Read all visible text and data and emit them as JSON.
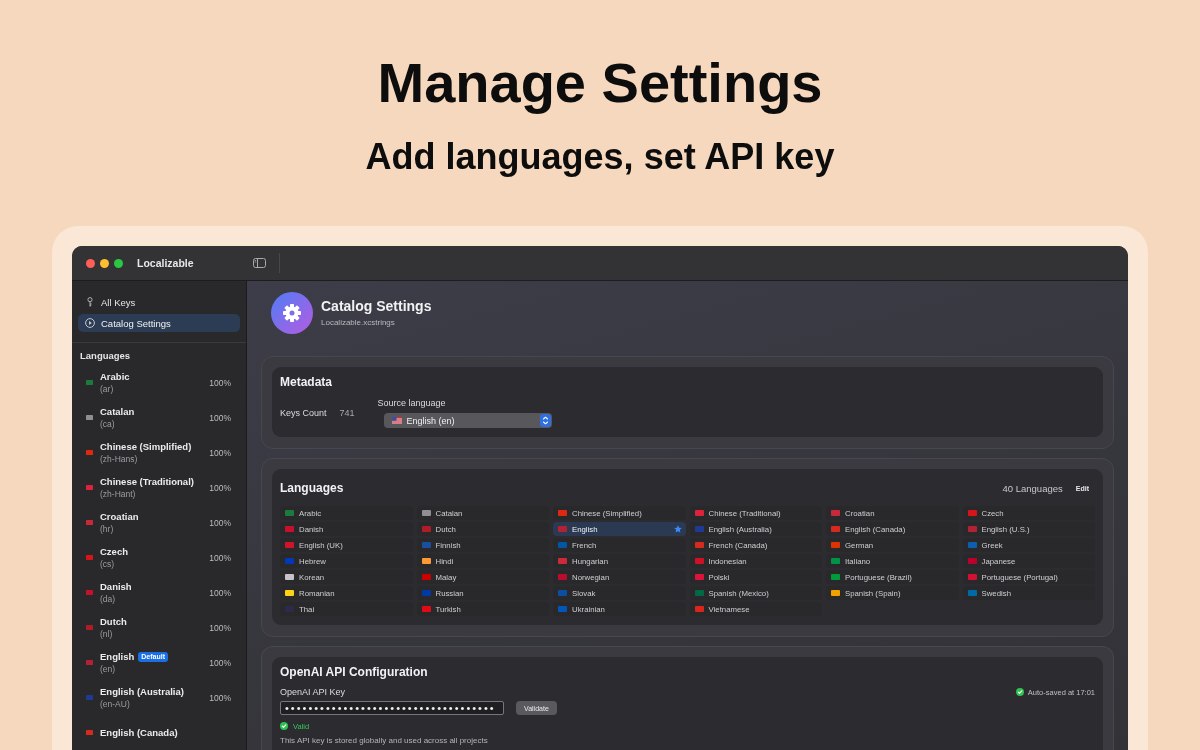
{
  "hero": {
    "title": "Manage Settings",
    "subtitle": "Add languages, set API key"
  },
  "window": {
    "title": "Localizable"
  },
  "sidebar": {
    "nav": [
      {
        "kind": "keys",
        "label": "All Keys",
        "selected": false
      },
      {
        "kind": "settings",
        "label": "Catalog Settings",
        "selected": true
      }
    ],
    "section_title": "Languages",
    "languages": [
      {
        "name": "Arabic",
        "code": "(ar)",
        "percent": "100%",
        "color": "#1d7a3d"
      },
      {
        "name": "Catalan",
        "code": "(ca)",
        "percent": "100%",
        "color": "#8e8e93"
      },
      {
        "name": "Chinese (Simplified)",
        "code": "(zh-Hans)",
        "percent": "100%",
        "color": "#de2910"
      },
      {
        "name": "Chinese (Traditional)",
        "code": "(zh-Hant)",
        "percent": "100%",
        "color": "#d9243c"
      },
      {
        "name": "Croatian",
        "code": "(hr)",
        "percent": "100%",
        "color": "#c8283b"
      },
      {
        "name": "Czech",
        "code": "(cs)",
        "percent": "100%",
        "color": "#d7141a"
      },
      {
        "name": "Danish",
        "code": "(da)",
        "percent": "100%",
        "color": "#c8102e"
      },
      {
        "name": "Dutch",
        "code": "(nl)",
        "percent": "100%",
        "color": "#ae1c28"
      },
      {
        "name": "English",
        "badge": "Default",
        "code": "(en)",
        "percent": "100%",
        "color": "#b22234"
      },
      {
        "name": "English (Australia)",
        "code": "(en-AU)",
        "percent": "100%",
        "color": "#1f3a93"
      },
      {
        "name": "English (Canada)",
        "color": "#d52b1e"
      }
    ]
  },
  "header": {
    "title": "Catalog Settings",
    "subtitle": "Localizable.xcstrings"
  },
  "metadata": {
    "title": "Metadata",
    "keys_count_label": "Keys Count",
    "keys_count": "741",
    "source_label": "Source language",
    "source_value": "English (en)"
  },
  "languages": {
    "title": "Languages",
    "count": "40 Languages",
    "edit": "Edit",
    "items": [
      {
        "name": "Arabic",
        "color": "#1d7a3d",
        "selected": false,
        "starred": false
      },
      {
        "name": "Catalan",
        "color": "#8e8e93",
        "selected": false,
        "starred": false
      },
      {
        "name": "Chinese (Simplified)",
        "color": "#de2910",
        "selected": false,
        "starred": false
      },
      {
        "name": "Chinese (Traditional)",
        "color": "#d9243c",
        "selected": false,
        "starred": false
      },
      {
        "name": "Croatian",
        "color": "#c8283b",
        "selected": false,
        "starred": false
      },
      {
        "name": "Czech",
        "color": "#d7141a",
        "selected": false,
        "starred": false
      },
      {
        "name": "Danish",
        "color": "#c8102e",
        "selected": false,
        "starred": false
      },
      {
        "name": "Dutch",
        "color": "#ae1c28",
        "selected": false,
        "starred": false
      },
      {
        "name": "English",
        "color": "#b22234",
        "selected": true,
        "starred": true
      },
      {
        "name": "English (Australia)",
        "color": "#1f3a93",
        "selected": false,
        "starred": false
      },
      {
        "name": "English (Canada)",
        "color": "#d52b1e",
        "selected": false,
        "starred": false
      },
      {
        "name": "English (U.S.)",
        "color": "#b22234",
        "selected": false,
        "starred": false
      },
      {
        "name": "English (UK)",
        "color": "#cf142b",
        "selected": false,
        "starred": false
      },
      {
        "name": "Finnish",
        "color": "#1a4fa0",
        "selected": false,
        "starred": false
      },
      {
        "name": "French",
        "color": "#0055a4",
        "selected": false,
        "starred": false
      },
      {
        "name": "French (Canada)",
        "color": "#d52b1e",
        "selected": false,
        "starred": false
      },
      {
        "name": "German",
        "color": "#dd3300",
        "selected": false,
        "starred": false
      },
      {
        "name": "Greek",
        "color": "#0d5eaf",
        "selected": false,
        "starred": false
      },
      {
        "name": "Hebrew",
        "color": "#0038b8",
        "selected": false,
        "starred": false
      },
      {
        "name": "Hindi",
        "color": "#ff9933",
        "selected": false,
        "starred": false
      },
      {
        "name": "Hungarian",
        "color": "#ce2939",
        "selected": false,
        "starred": false
      },
      {
        "name": "Indonesian",
        "color": "#ce1126",
        "selected": false,
        "starred": false
      },
      {
        "name": "Italiano",
        "color": "#009246",
        "selected": false,
        "starred": false
      },
      {
        "name": "Japanese",
        "color": "#bc002d",
        "selected": false,
        "starred": false
      },
      {
        "name": "Korean",
        "color": "#c4c4c8",
        "selected": false,
        "starred": false
      },
      {
        "name": "Malay",
        "color": "#cc0001",
        "selected": false,
        "starred": false
      },
      {
        "name": "Norwegian",
        "color": "#ba0c2f",
        "selected": false,
        "starred": false
      },
      {
        "name": "Polski",
        "color": "#dc143c",
        "selected": false,
        "starred": false
      },
      {
        "name": "Portuguese (Brazil)",
        "color": "#009c3b",
        "selected": false,
        "starred": false
      },
      {
        "name": "Portuguese (Portugal)",
        "color": "#d21034",
        "selected": false,
        "starred": false
      },
      {
        "name": "Romanian",
        "color": "#fcd116",
        "selected": false,
        "starred": false
      },
      {
        "name": "Russian",
        "color": "#0039a6",
        "selected": false,
        "starred": false
      },
      {
        "name": "Slovak",
        "color": "#0b4ea2",
        "selected": false,
        "starred": false
      },
      {
        "name": "Spanish (Mexico)",
        "color": "#006847",
        "selected": false,
        "starred": false
      },
      {
        "name": "Spanish (Spain)",
        "color": "#f1a000",
        "selected": false,
        "starred": false
      },
      {
        "name": "Swedish",
        "color": "#006aa7",
        "selected": false,
        "starred": false
      },
      {
        "name": "Thai",
        "color": "#2d2a4a",
        "selected": false,
        "starred": false
      },
      {
        "name": "Turkish",
        "color": "#e30a17",
        "selected": false,
        "starred": false
      },
      {
        "name": "Ukrainian",
        "color": "#0057b7",
        "selected": false,
        "starred": false
      },
      {
        "name": "Vietnamese",
        "color": "#da251d",
        "selected": false,
        "starred": false
      }
    ]
  },
  "openai": {
    "title": "OpenAI API Configuration",
    "key_label": "OpenAI API Key",
    "key_value": "••••••••••••••••••••••••••••••••••••",
    "validate": "Validate",
    "autosave": "Auto-saved at 17:01",
    "status": "Valid",
    "note": "This API key is stored globally and used across all projects"
  }
}
